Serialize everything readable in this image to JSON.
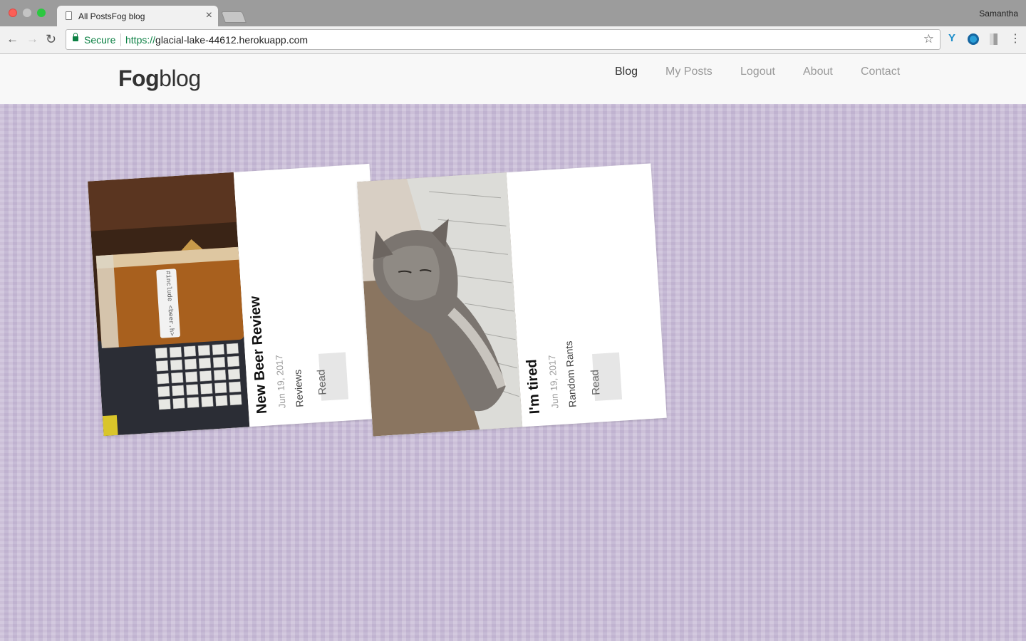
{
  "browser": {
    "tab_title": "All PostsFog blog",
    "user": "Samantha",
    "secure_label": "Secure",
    "url_scheme": "https://",
    "url_host": "glacial-lake-44612.herokuapp.com"
  },
  "site": {
    "brand_strong": "Fog",
    "brand_light": "blog",
    "nav": [
      "Blog",
      "My Posts",
      "Logout",
      "About",
      "Contact"
    ]
  },
  "posts": [
    {
      "title": "New Beer Review",
      "date": "Jun 19, 2017",
      "category": "Reviews",
      "read_label": "Read",
      "image": "beer-glass-photo",
      "photo_label": "#include <beer.h>"
    },
    {
      "title": "I'm tired",
      "date": "Jun 19, 2017",
      "category": "Random Rants",
      "read_label": "Read",
      "image": "kitten-on-keyboard-photo"
    }
  ],
  "icons": {
    "back": "back-arrow-icon",
    "forward": "forward-arrow-icon",
    "reload": "reload-icon",
    "lock": "lock-icon",
    "star": "bookmark-star-icon",
    "menu": "kebab-menu-icon"
  },
  "colors": {
    "background": "#cbbfd9",
    "secure_green": "#0b8043",
    "header_bg": "#f8f8f8"
  }
}
